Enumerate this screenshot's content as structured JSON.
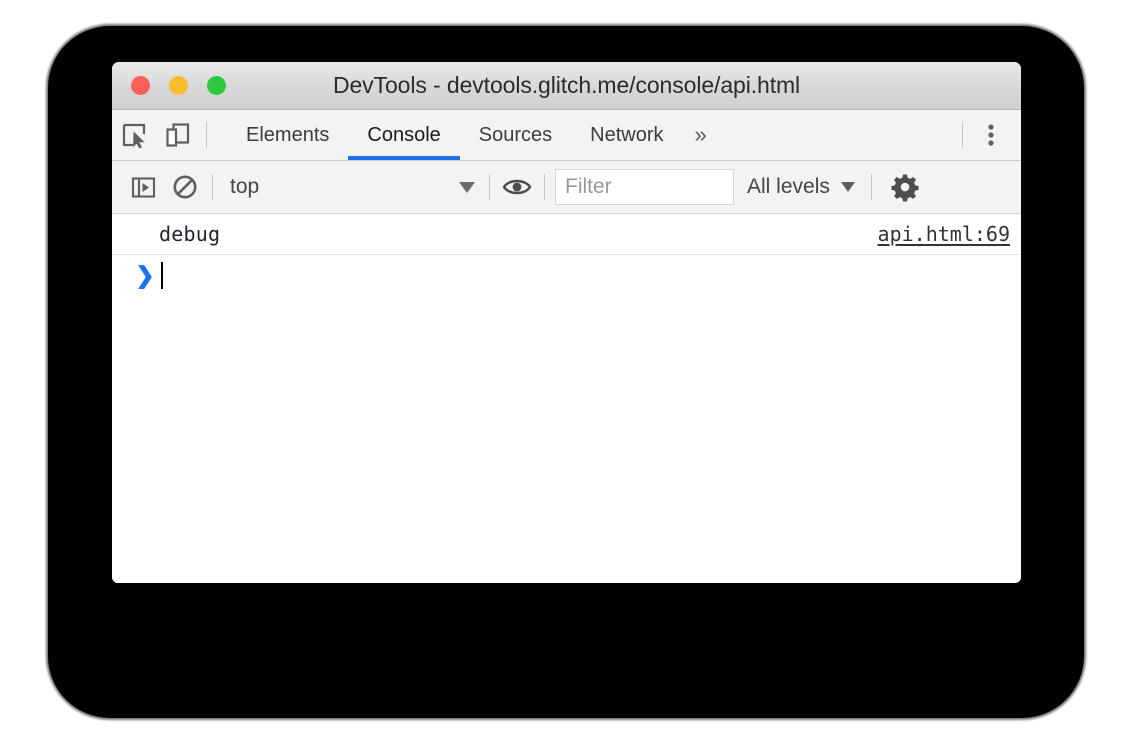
{
  "window": {
    "title": "DevTools - devtools.glitch.me/console/api.html",
    "traffic_lights": [
      {
        "name": "close",
        "color": "#fb6158"
      },
      {
        "name": "minimize",
        "color": "#fbbd2e"
      },
      {
        "name": "maximize",
        "color": "#2bc840"
      }
    ]
  },
  "tabbar": {
    "inspect_icon": "inspect-element-icon",
    "device_icon": "device-toolbar-icon",
    "tabs": [
      {
        "label": "Elements",
        "active": false
      },
      {
        "label": "Console",
        "active": true
      },
      {
        "label": "Sources",
        "active": false
      },
      {
        "label": "Network",
        "active": false
      }
    ],
    "overflow_label": "»",
    "menu_icon": "more-vertical-icon",
    "active_underline_color": "#1a73e8"
  },
  "console_toolbar": {
    "sidebar_toggle_icon": "console-sidebar-icon",
    "clear_icon": "clear-console-icon",
    "context": {
      "value": "top",
      "caret": "▼"
    },
    "eye_icon": "create-live-expression-icon",
    "filter": {
      "value": "",
      "placeholder": "Filter"
    },
    "levels": {
      "value": "All levels",
      "caret": "▼"
    },
    "settings_icon": "settings-gear-icon"
  },
  "console_messages": [
    {
      "text": "debug",
      "source": "api.html:69"
    }
  ],
  "prompt": {
    "caret": "❯",
    "value": ""
  }
}
